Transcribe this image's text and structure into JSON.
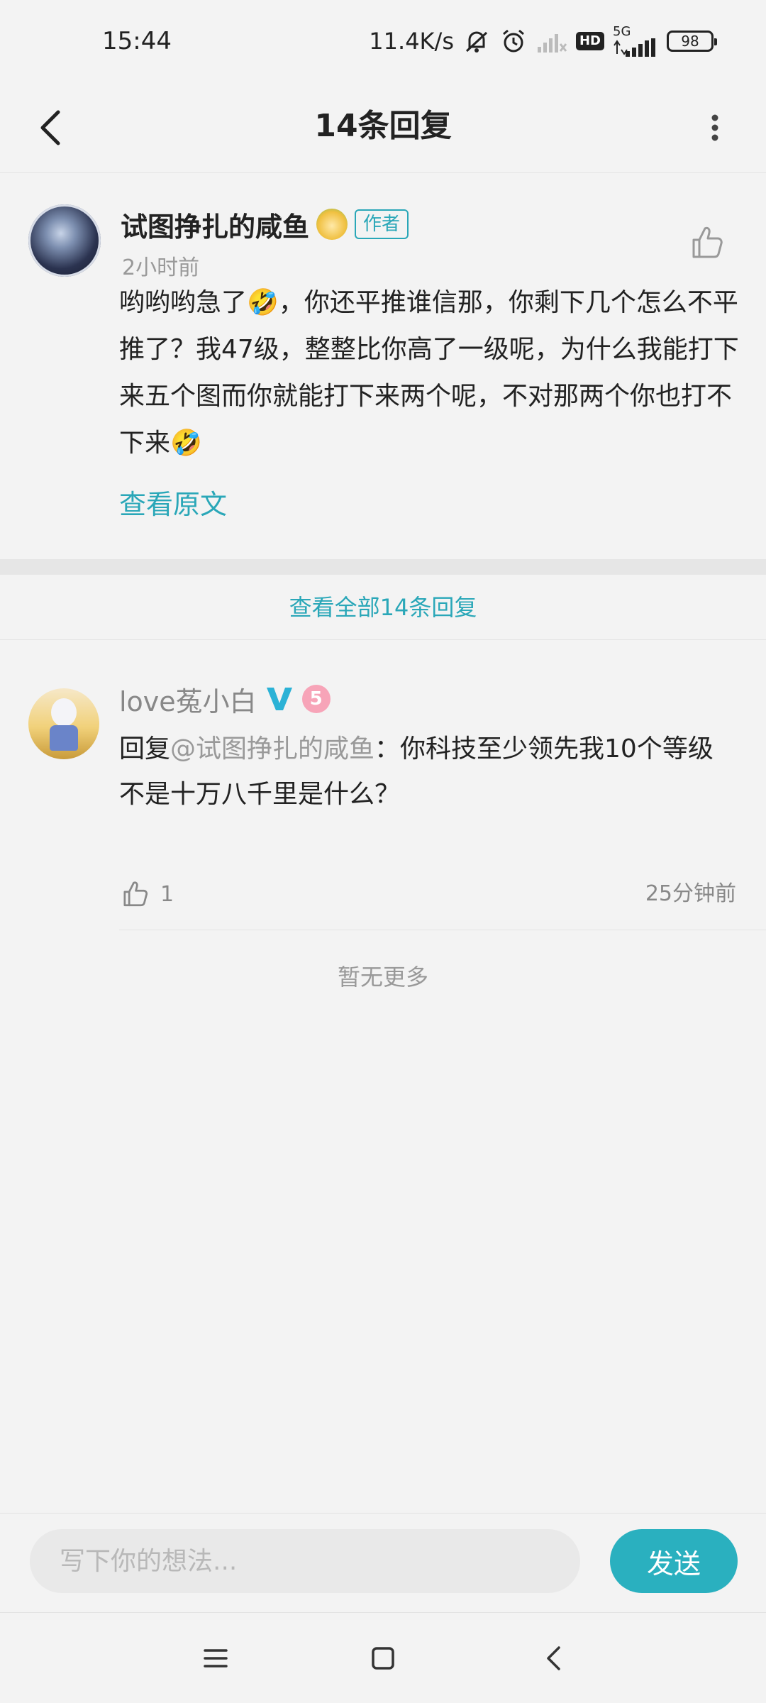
{
  "status_bar": {
    "time": "15:44",
    "net_speed": "11.4K/s",
    "hd_label": "HD",
    "network_type": "5G",
    "battery": "98"
  },
  "header": {
    "title": "14条回复"
  },
  "main_comment": {
    "author": "试图挣扎的咸鱼",
    "author_tag": "作者",
    "time": "2小时前",
    "text": "哟哟哟急了🤣，你还平推谁信那，你剩下几个怎么不平推了？我47级，整整比你高了一级呢，为什么我能打下来五个图而你就能打下来两个呢，不对那两个你也打不下来🤣",
    "view_original": "查看原文"
  },
  "view_all": "查看全部14条回复",
  "reply": {
    "user": "love菟小白",
    "level": "5",
    "prefix": "回复",
    "mention": "@试图挣扎的咸鱼",
    "text_line1": "：你科技至少领先我10个等级",
    "text_line2": "不是十万八千里是什么？",
    "like_count": "1",
    "time": "25分钟前"
  },
  "no_more": "暂无更多",
  "input": {
    "placeholder": "写下你的想法...",
    "send_label": "发送"
  },
  "colors": {
    "accent": "#2aa7b8",
    "send_button": "#2ab0bf",
    "background": "#f3f3f3"
  },
  "icons": {
    "back": "chevron-left-icon",
    "more": "more-vertical-icon",
    "like": "thumbs-up-icon",
    "vip": "vip-v-icon",
    "nav_menu": "menu-icon",
    "nav_home": "square-home-icon",
    "nav_back": "back-triangle-icon"
  }
}
